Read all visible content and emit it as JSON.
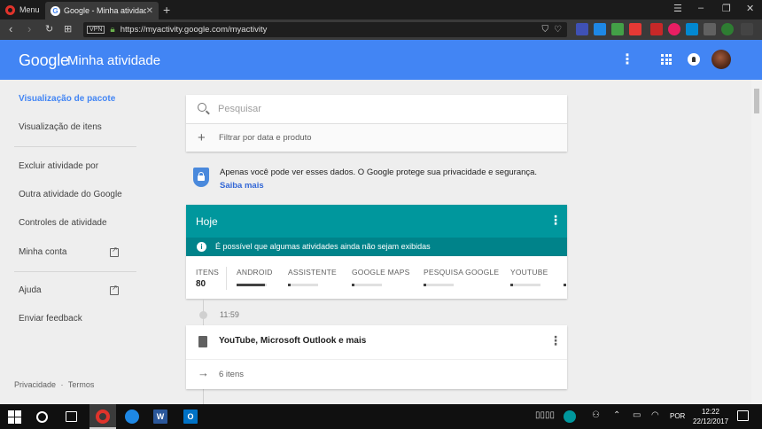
{
  "browser": {
    "menu_label": "Menu",
    "tab_title": "Google - Minha atividade",
    "tab_close": "✕",
    "new_tab": "+",
    "vpn_label": "VPN",
    "url": "https://myactivity.google.com/myactivity"
  },
  "header": {
    "logo": "Google",
    "title": "Minha atividade"
  },
  "sidebar": {
    "items": [
      {
        "label": "Visualização de pacote"
      },
      {
        "label": "Visualização de itens"
      },
      {
        "label": "Excluir atividade por"
      },
      {
        "label": "Outra atividade do Google"
      },
      {
        "label": "Controles de atividade"
      },
      {
        "label": "Minha conta"
      },
      {
        "label": "Ajuda"
      },
      {
        "label": "Enviar feedback"
      }
    ],
    "footer": {
      "privacy": "Privacidade",
      "separator": "·",
      "terms": "Termos"
    }
  },
  "search": {
    "placeholder": "Pesquisar",
    "filter_label": "Filtrar por data e produto"
  },
  "privacy": {
    "text": "Apenas você pode ver esses dados. O Google protege sua privacidade e segurança. ",
    "link": "Saiba mais"
  },
  "today": {
    "title": "Hoje",
    "note": "É possível que algumas atividades ainda não sejam exibidas",
    "items_label": "ITENS",
    "items_value": "80",
    "products": [
      {
        "label": "ANDROID",
        "fill": 0.95
      },
      {
        "label": "ASSISTENTE",
        "fill": 0.05
      },
      {
        "label": "GOOGLE MAPS",
        "fill": 0.05
      },
      {
        "label": "PESQUISA GOOGLE",
        "fill": 0.05
      },
      {
        "label": "YOUTUBE",
        "fill": 0.05
      }
    ]
  },
  "timeline": {
    "time": "11:59"
  },
  "bundle": {
    "title": "YouTube, Microsoft Outlook e mais",
    "count": "6 itens"
  },
  "taskbar": {
    "word_letter": "W",
    "outlook_letter": "O",
    "lang": "POR",
    "time": "12:22",
    "date": "22/12/2017"
  }
}
